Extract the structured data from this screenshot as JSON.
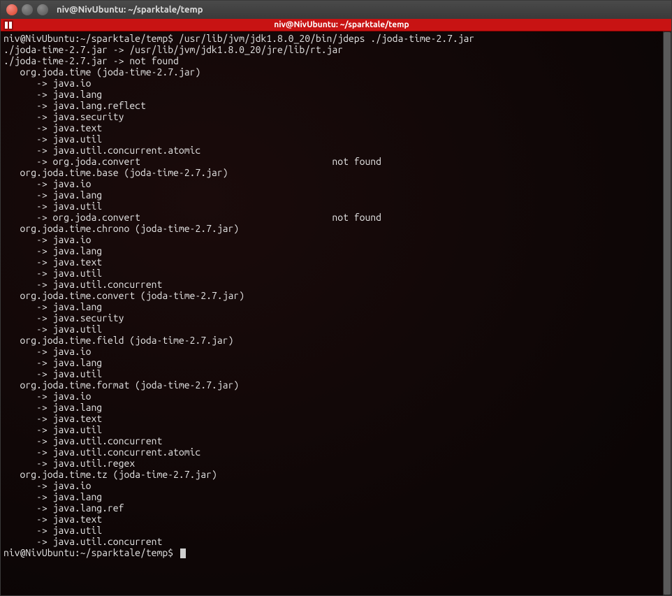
{
  "titlebar": {
    "text": "niv@NivUbuntu: ~/sparktale/temp"
  },
  "menubar": {
    "title": "niv@NivUbuntu: ~/sparktale/temp"
  },
  "terminal": {
    "prompt1": "niv@NivUbuntu:~/sparktale/temp$ ",
    "cmd1": "/usr/lib/jvm/jdk1.8.0_20/bin/jdeps ./joda-time-2.7.jar",
    "lines": [
      "./joda-time-2.7.jar -> /usr/lib/jvm/jdk1.8.0_20/jre/lib/rt.jar",
      "./joda-time-2.7.jar -> not found",
      "   org.joda.time (joda-time-2.7.jar)",
      "      -> java.io",
      "      -> java.lang",
      "      -> java.lang.reflect",
      "      -> java.security",
      "      -> java.text",
      "      -> java.util",
      "      -> java.util.concurrent.atomic",
      "      -> org.joda.convert                                   not found",
      "   org.joda.time.base (joda-time-2.7.jar)",
      "      -> java.io",
      "      -> java.lang",
      "      -> java.util",
      "      -> org.joda.convert                                   not found",
      "   org.joda.time.chrono (joda-time-2.7.jar)",
      "      -> java.io",
      "      -> java.lang",
      "      -> java.text",
      "      -> java.util",
      "      -> java.util.concurrent",
      "   org.joda.time.convert (joda-time-2.7.jar)",
      "      -> java.lang",
      "      -> java.security",
      "      -> java.util",
      "   org.joda.time.field (joda-time-2.7.jar)",
      "      -> java.io",
      "      -> java.lang",
      "      -> java.util",
      "   org.joda.time.format (joda-time-2.7.jar)",
      "      -> java.io",
      "      -> java.lang",
      "      -> java.text",
      "      -> java.util",
      "      -> java.util.concurrent",
      "      -> java.util.concurrent.atomic",
      "      -> java.util.regex",
      "   org.joda.time.tz (joda-time-2.7.jar)",
      "      -> java.io",
      "      -> java.lang",
      "      -> java.lang.ref",
      "      -> java.text",
      "      -> java.util",
      "      -> java.util.concurrent"
    ],
    "prompt2": "niv@NivUbuntu:~/sparktale/temp$ "
  }
}
